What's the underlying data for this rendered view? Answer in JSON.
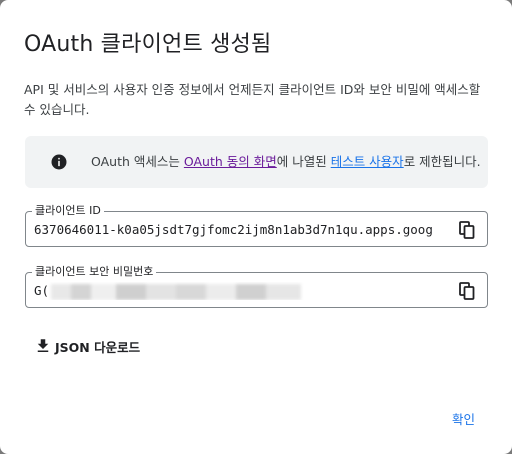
{
  "dialog": {
    "title": "OAuth 클라이언트 생성됨",
    "description": "API 및 서비스의 사용자 인증 정보에서 언제든지 클라이언트 ID와 보안 비밀에 액세스할 수 있습니다.",
    "notice": {
      "icon": "info-icon",
      "prefix": "OAuth 액세스는 ",
      "consent_link": "OAuth 동의 화면",
      "middle": "에 나열된 ",
      "test_users_link": "테스트 사용자",
      "suffix": "로 제한됩니다."
    },
    "client_id": {
      "label": "클라이언트 ID",
      "value": "6370646011-k0a05jsdt7gjfomc2ijm8n1ab3d7n1qu.apps.goog",
      "copy_icon": "copy-icon"
    },
    "client_secret": {
      "label": "클라이언트 보안 비밀번호",
      "value_visible": "G(",
      "copy_icon": "copy-icon"
    },
    "download_label": "JSON 다운로드",
    "confirm_label": "확인"
  },
  "colors": {
    "link_consent": "#6a1b9a",
    "link_test_users": "#1a73e8",
    "accent": "#1a73e8",
    "notice_bg": "#f1f3f4"
  }
}
